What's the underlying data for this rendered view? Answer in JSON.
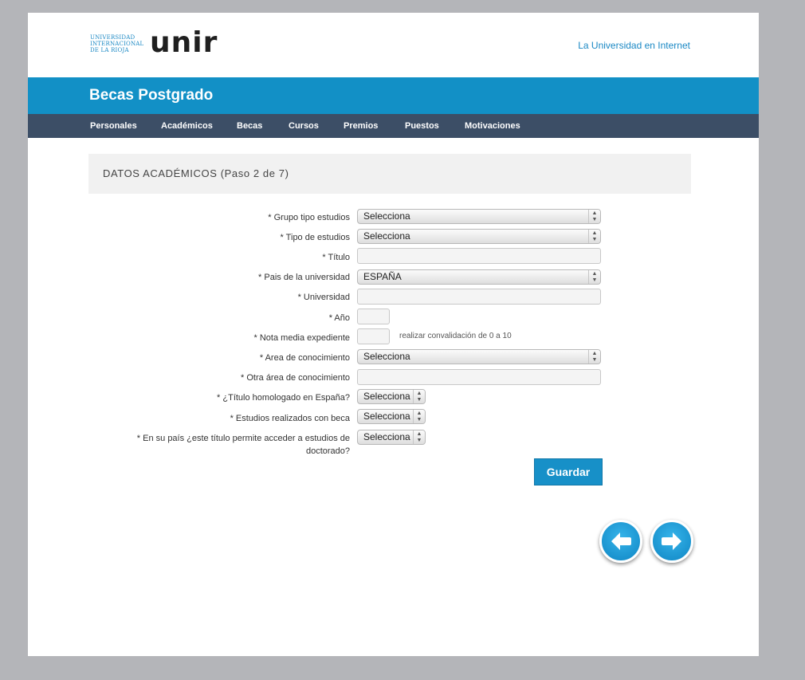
{
  "header": {
    "logo_lines": [
      "UNIVERSIDAD",
      "INTERNACIONAL",
      "DE LA RIOJA"
    ],
    "logo_text": "unir",
    "tagline": "La Universidad en Internet"
  },
  "titlebar": {
    "title": "Becas Postgrado"
  },
  "nav": {
    "items": [
      {
        "label": "Personales"
      },
      {
        "label": "Académicos"
      },
      {
        "label": "Becas"
      },
      {
        "label": "Cursos"
      },
      {
        "label": "Premios"
      },
      {
        "label": "Puestos"
      },
      {
        "label": "Motivaciones"
      }
    ]
  },
  "section": {
    "heading": "DATOS ACADÉMICOS (Paso 2 de 7)"
  },
  "form": {
    "grupo_tipo": {
      "label": "* Grupo tipo estudios",
      "value": "Selecciona"
    },
    "tipo_estudios": {
      "label": "* Tipo de estudios",
      "value": "Selecciona"
    },
    "titulo": {
      "label": "* Título",
      "value": ""
    },
    "pais": {
      "label": "* Pais de la universidad",
      "value": "ESPAÑA"
    },
    "universidad": {
      "label": "* Universidad",
      "value": ""
    },
    "anio": {
      "label": "* Año",
      "value": ""
    },
    "nota": {
      "label": "* Nota media expediente",
      "value": "",
      "hint": "realizar convalidación de 0 a 10"
    },
    "area": {
      "label": "* Area de conocimiento",
      "value": "Selecciona"
    },
    "otra_area": {
      "label": "* Otra área de conocimiento",
      "value": ""
    },
    "homologado": {
      "label": "* ¿Título homologado en España?",
      "value": "Selecciona"
    },
    "con_beca": {
      "label": "* Estudios realizados con beca",
      "value": "Selecciona"
    },
    "doctorado": {
      "label_line1": "* En su país ¿este título permite acceder a estudios de",
      "label_line2": "doctorado?",
      "value": "Selecciona"
    },
    "save_label": "Guardar"
  },
  "icons": {
    "prev": "arrow-left-icon",
    "next": "arrow-right-icon"
  },
  "colors": {
    "brand_blue": "#1290c6",
    "nav_dark": "#3c4e66"
  }
}
